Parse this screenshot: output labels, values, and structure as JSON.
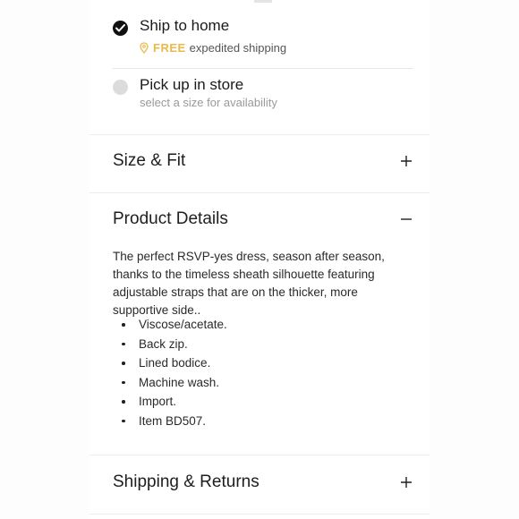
{
  "shipping": {
    "ship_to_home": {
      "title": "Ship to home",
      "selected": true,
      "free_label": "FREE",
      "subtitle": "expedited shipping"
    },
    "pick_up": {
      "title": "Pick up in store",
      "selected": false,
      "subtitle": "select a size for availability"
    }
  },
  "sections": {
    "size_fit": {
      "title": "Size & Fit",
      "expanded": false
    },
    "product_details": {
      "title": "Product Details",
      "expanded": true,
      "description": "The perfect RSVP-yes dress, season after season, thanks to the timeless sheath silhouette featuring adjustable straps that are on the thicker, more supportive side..",
      "features": [
        "Viscose/acetate.",
        "Back zip.",
        "Lined bodice.",
        "Machine wash.",
        "Import.",
        "Item BD507."
      ]
    },
    "shipping_returns": {
      "title": "Shipping & Returns",
      "expanded": false
    }
  },
  "colors": {
    "accent_free": "#e9b949",
    "text": "#1e1e1e",
    "muted": "#9a9a9a",
    "radio_checked": "#111111",
    "radio_unchecked": "#dcdcdc"
  },
  "icons": {
    "selected": "checkmark-icon",
    "free": "location-pin-icon",
    "expand": "plus-icon",
    "collapse": "minus-icon"
  }
}
